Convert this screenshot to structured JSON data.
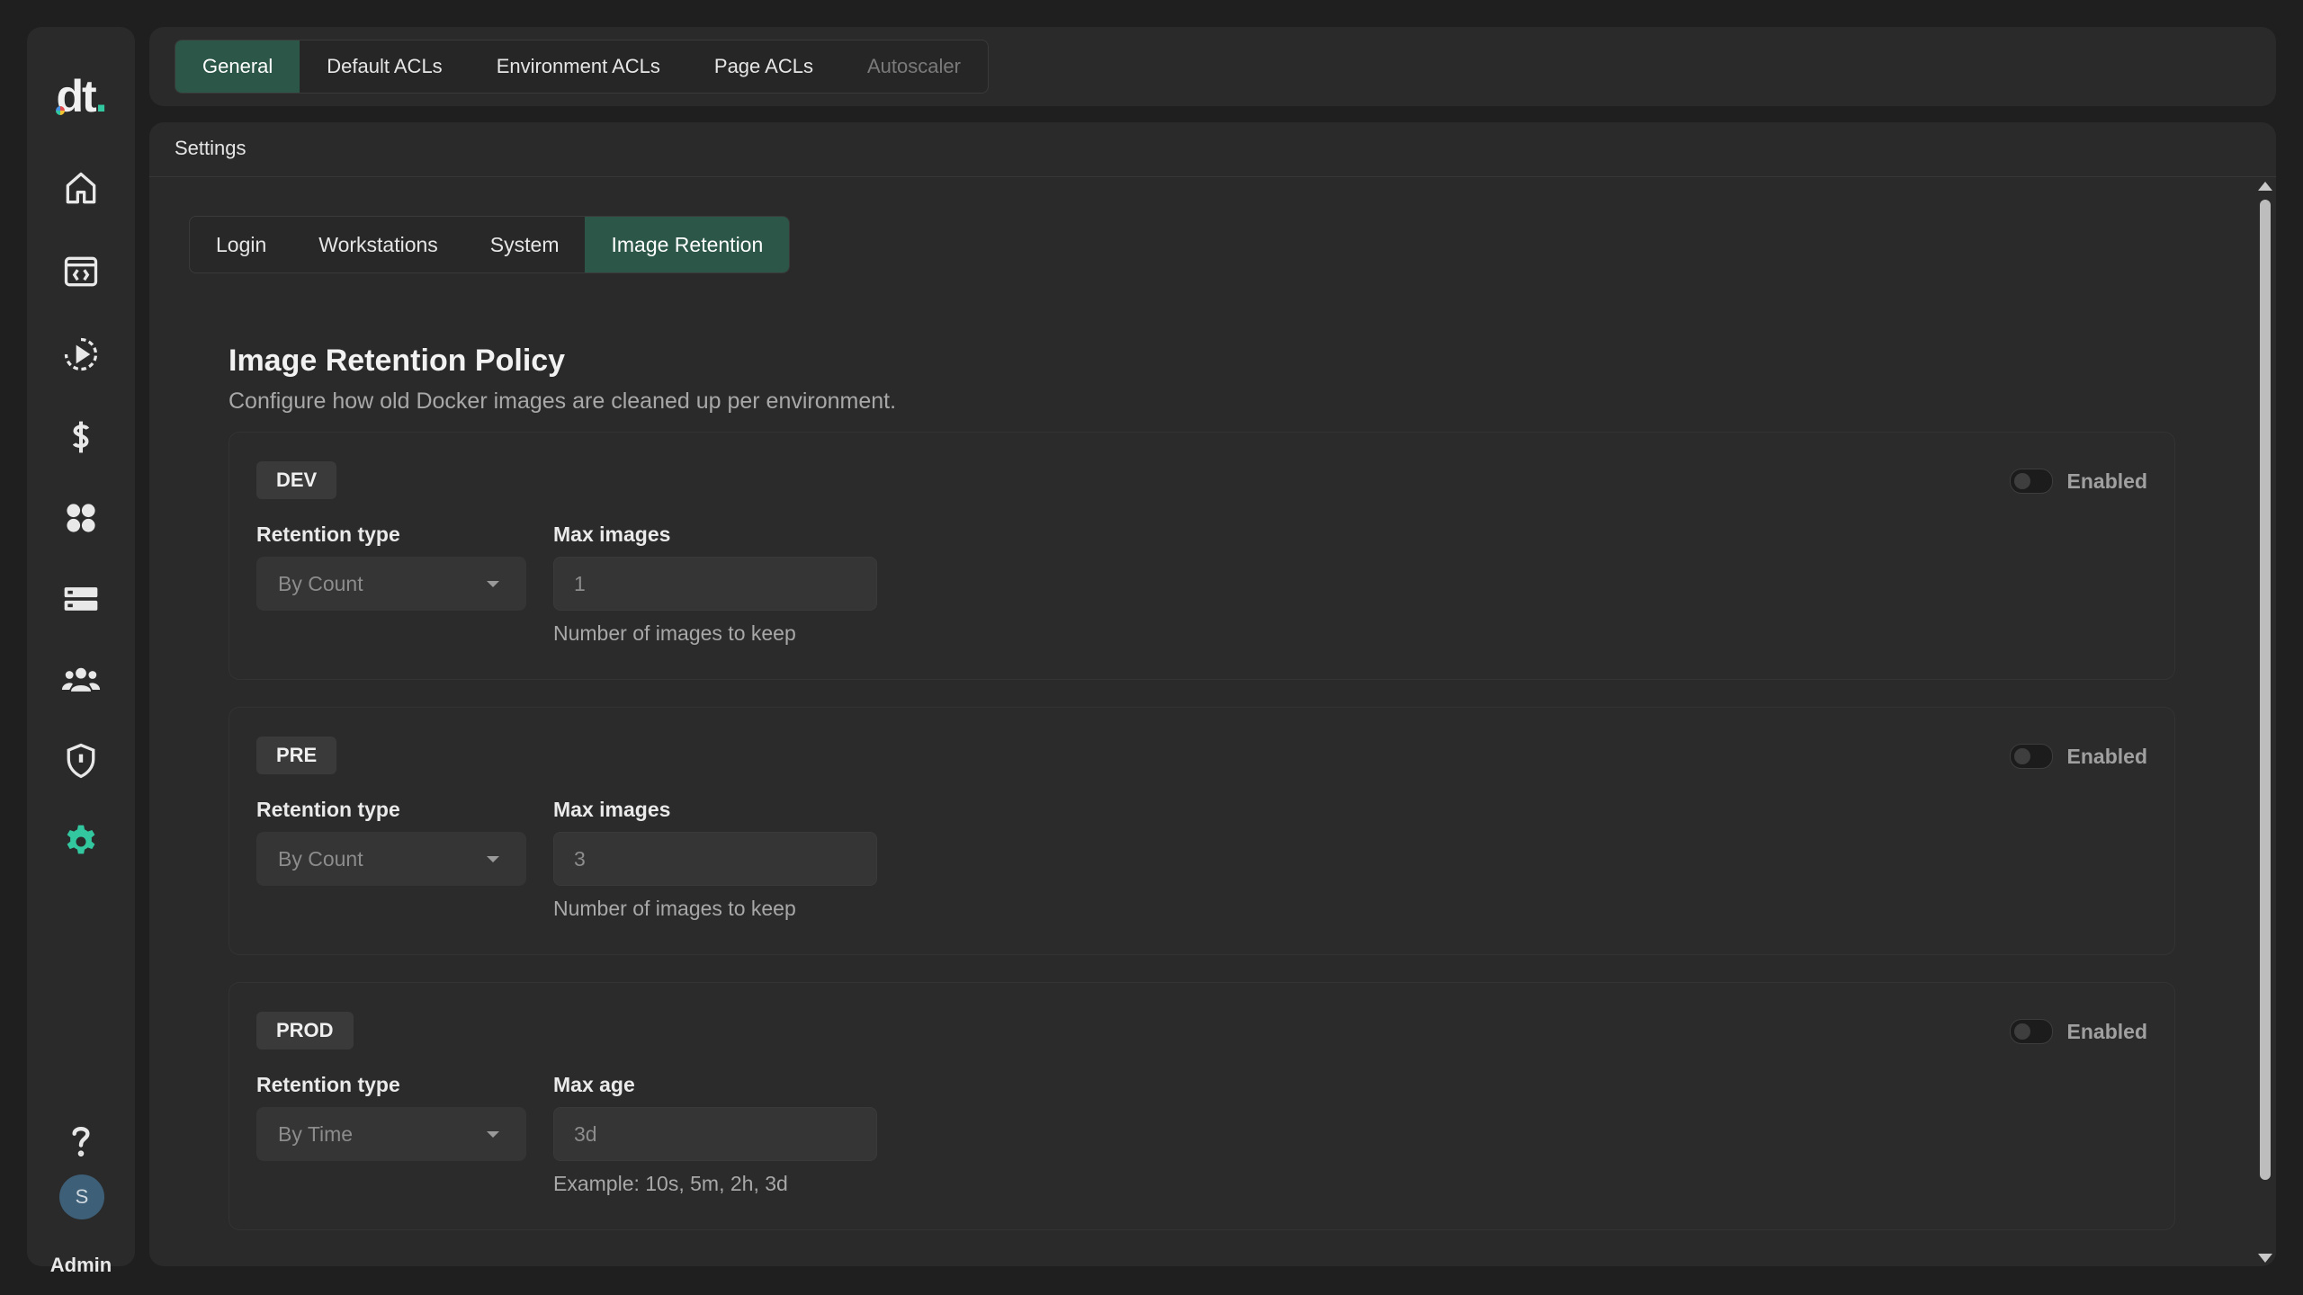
{
  "sidebar": {
    "logo": "dt",
    "user_initial": "S",
    "user_label": "Admin",
    "icons": [
      "home-icon",
      "code-window-icon",
      "play-circle-icon",
      "dollar-icon",
      "apps-grid-icon",
      "server-icon",
      "users-icon",
      "shield-icon",
      "gear-icon",
      "help-icon"
    ],
    "active_color": "#33c7a0"
  },
  "top_tabs": [
    {
      "label": "General",
      "state": "active"
    },
    {
      "label": "Default ACLs",
      "state": "normal"
    },
    {
      "label": "Environment ACLs",
      "state": "normal"
    },
    {
      "label": "Page ACLs",
      "state": "normal"
    },
    {
      "label": "Autoscaler",
      "state": "disabled"
    }
  ],
  "panel": {
    "header": "Settings",
    "sub_tabs": [
      {
        "label": "Login"
      },
      {
        "label": "Workstations"
      },
      {
        "label": "System"
      },
      {
        "label": "Image Retention",
        "active": true
      }
    ],
    "title": "Image Retention Policy",
    "description": "Configure how old Docker images are cleaned up per environment."
  },
  "environments": [
    {
      "name": "DEV",
      "toggle_label": "Enabled",
      "retention_type_label": "Retention type",
      "retention_type_value": "By Count",
      "value_label": "Max images",
      "value": "1",
      "helper": "Number of images to keep"
    },
    {
      "name": "PRE",
      "toggle_label": "Enabled",
      "retention_type_label": "Retention type",
      "retention_type_value": "By Count",
      "value_label": "Max images",
      "value": "3",
      "helper": "Number of images to keep"
    },
    {
      "name": "PROD",
      "toggle_label": "Enabled",
      "retention_type_label": "Retention type",
      "retention_type_value": "By Time",
      "value_label": "Max age",
      "value": "3d",
      "helper": "Example: 10s, 5m, 2h, 3d"
    }
  ],
  "colors": {
    "accent": "#2c5647",
    "background": "#1f1f1f",
    "surface": "#2a2a2a"
  }
}
